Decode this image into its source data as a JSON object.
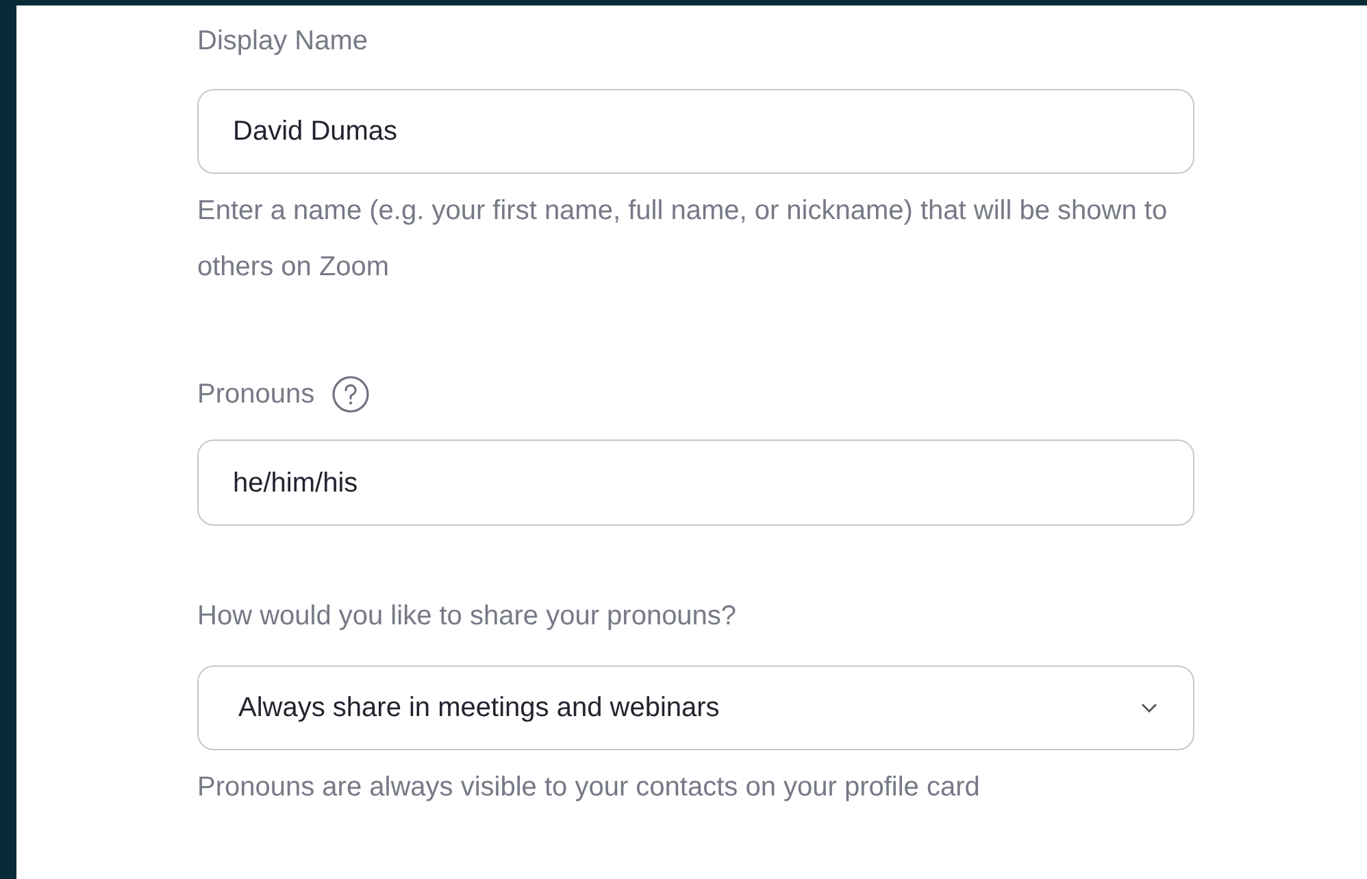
{
  "display_name": {
    "label": "Display Name",
    "value": "David Dumas",
    "helper": "Enter a name (e.g. your first name, full name, or nickname) that will be shown to others on Zoom"
  },
  "pronouns": {
    "label": "Pronouns",
    "value": "he/him/his"
  },
  "share_pronouns": {
    "label": "How would you like to share your pronouns?",
    "value": "Always share in meetings and webinars",
    "helper": "Pronouns are always visible to your contacts on your profile card"
  }
}
